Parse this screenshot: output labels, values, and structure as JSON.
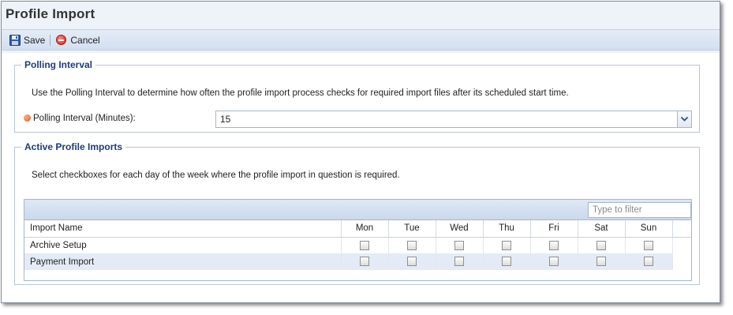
{
  "window": {
    "title": "Profile Import"
  },
  "toolbar": {
    "save_label": "Save",
    "cancel_label": "Cancel"
  },
  "polling": {
    "legend": "Polling Interval",
    "description": "Use the Polling Interval to determine how often the profile import process checks for required import files after its scheduled start time.",
    "label": "Polling Interval (Minutes):",
    "value": "15"
  },
  "imports": {
    "legend": "Active Profile Imports",
    "description": "Select checkboxes for each day of the week where the profile import in question is required.",
    "filter_placeholder": "Type to filter",
    "columns": {
      "name": "Import Name",
      "mon": "Mon",
      "tue": "Tue",
      "wed": "Wed",
      "thu": "Thu",
      "fri": "Fri",
      "sat": "Sat",
      "sun": "Sun"
    },
    "rows": [
      {
        "name": "Archive Setup",
        "days": [
          false,
          false,
          false,
          false,
          false,
          false,
          false
        ]
      },
      {
        "name": "Payment Import",
        "days": [
          false,
          false,
          false,
          false,
          false,
          false,
          false
        ]
      }
    ]
  },
  "colors": {
    "legend_text": "#1d3d7a",
    "required_dot": "#e0521a",
    "cancel_icon": "#d2221a",
    "alt_row": "#e4ebf6"
  },
  "icons": {
    "save": "floppy-disk-icon",
    "cancel": "cancel-circle-icon",
    "dropdown": "chevron-down-icon",
    "required": "required-dot-icon"
  }
}
